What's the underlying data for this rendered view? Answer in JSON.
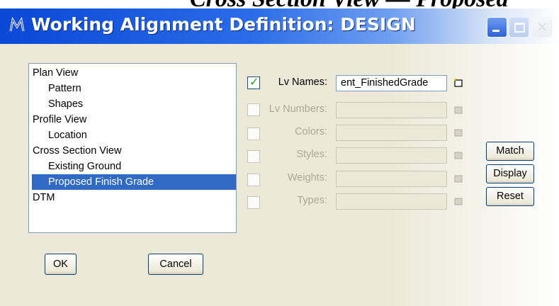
{
  "background": {
    "text": "Cross Section View — Proposed"
  },
  "window": {
    "title": "Working Alignment Definition: DESIGN",
    "app_icon": "microstation-icon",
    "controls": [
      "minimize",
      "maximize",
      "close"
    ]
  },
  "tree": {
    "items": [
      {
        "label": "Plan View",
        "level": 0,
        "selected": false
      },
      {
        "label": "Pattern",
        "level": 1,
        "selected": false
      },
      {
        "label": "Shapes",
        "level": 1,
        "selected": false
      },
      {
        "label": "Profile View",
        "level": 0,
        "selected": false
      },
      {
        "label": "Location",
        "level": 1,
        "selected": false
      },
      {
        "label": "Cross Section View",
        "level": 0,
        "selected": false
      },
      {
        "label": "Existing Ground",
        "level": 1,
        "selected": false
      },
      {
        "label": "Proposed Finish Grade",
        "level": 1,
        "selected": true
      },
      {
        "label": "DTM",
        "level": 0,
        "selected": false
      }
    ]
  },
  "properties": {
    "rows": [
      {
        "label": "Lv Names:",
        "checked": true,
        "enabled": true,
        "value": "ent_FinishedGrade"
      },
      {
        "label": "Lv Numbers:",
        "checked": false,
        "enabled": false,
        "value": ""
      },
      {
        "label": "Colors:",
        "checked": false,
        "enabled": false,
        "value": ""
      },
      {
        "label": "Styles:",
        "checked": false,
        "enabled": false,
        "value": ""
      },
      {
        "label": "Weights:",
        "checked": false,
        "enabled": false,
        "value": ""
      },
      {
        "label": "Types:",
        "checked": false,
        "enabled": false,
        "value": ""
      }
    ],
    "picker_icon": "pick-element-icon"
  },
  "buttons": {
    "match": "Match",
    "display": "Display",
    "reset": "Reset",
    "ok": "OK",
    "cancel": "Cancel"
  },
  "colors": {
    "title_bar": "#0a48d6",
    "selection": "#316ac5",
    "dialog_face": "#ece9d8",
    "check_green": "#21a121"
  }
}
